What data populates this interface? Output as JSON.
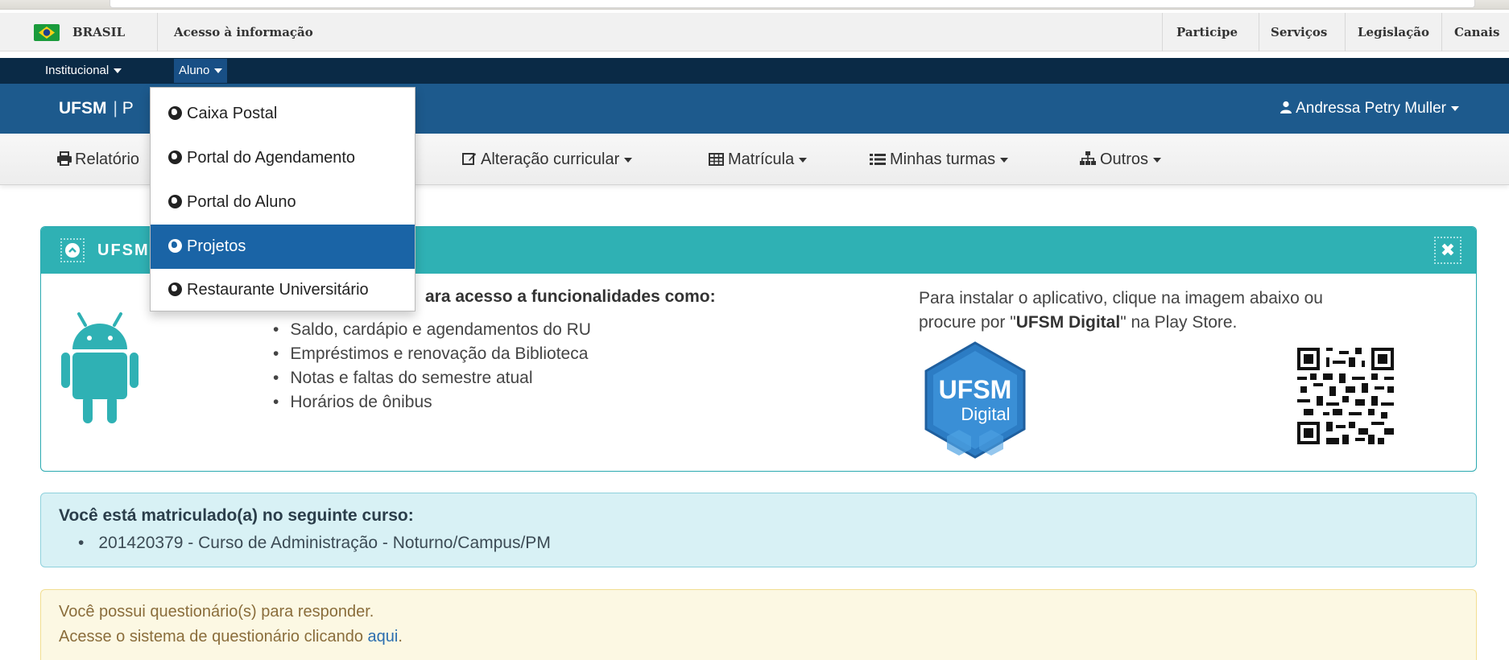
{
  "gov_bar": {
    "country": "BRASIL",
    "info_link": "Acesso à informação",
    "right_links": [
      "Participe",
      "Serviços",
      "Legislação",
      "Canais"
    ],
    "flag_icon": "brazil-flag-icon"
  },
  "inst_bar": {
    "institucional": "Institucional",
    "aluno": "Aluno"
  },
  "app_header": {
    "brand": "UFSM",
    "brand_suffix": "P",
    "user": "Andressa Petry Muller"
  },
  "menu": {
    "relatorios": "Relatório",
    "alteracao": "Alteração curricular",
    "matricula": "Matrícula",
    "minhas_turmas": "Minhas turmas",
    "outros": "Outros"
  },
  "dropdown": {
    "items": [
      {
        "label": "Caixa Postal",
        "icon": "globe-icon"
      },
      {
        "label": "Portal do Agendamento",
        "icon": "globe-icon"
      },
      {
        "label": "Portal do Aluno",
        "icon": "globe-icon"
      },
      {
        "label": "Projetos",
        "icon": "globe-icon",
        "active": true
      },
      {
        "label": "Restaurante Universitário",
        "icon": "globe-icon"
      }
    ]
  },
  "digital_panel": {
    "title": "UFSM",
    "intro": "ara acesso a funcionalidades como:",
    "features": [
      "Saldo, cardápio e agendamentos do RU",
      "Empréstimos e renovação da Biblioteca",
      "Notas e faltas do semestre atual",
      "Horários de ônibus"
    ],
    "install_pre": "Para instalar o aplicativo, clique na imagem abaixo ou procure por \"",
    "install_app": "UFSM Digital",
    "install_post": "\" na Play Store.",
    "logo_line1": "UFSM",
    "logo_line2": "Digital",
    "accent": "#2fb1b4"
  },
  "course_box": {
    "title": "Você está matriculado(a) no seguinte curso:",
    "course": "201420379 - Curso de Administração - Noturno/Campus/PM"
  },
  "questionnaire_box": {
    "line1": "Você possui questionário(s) para responder.",
    "line2_pre": "Acesse o sistema de questionário clicando ",
    "line2_link": "aqui",
    "line2_post": "."
  }
}
